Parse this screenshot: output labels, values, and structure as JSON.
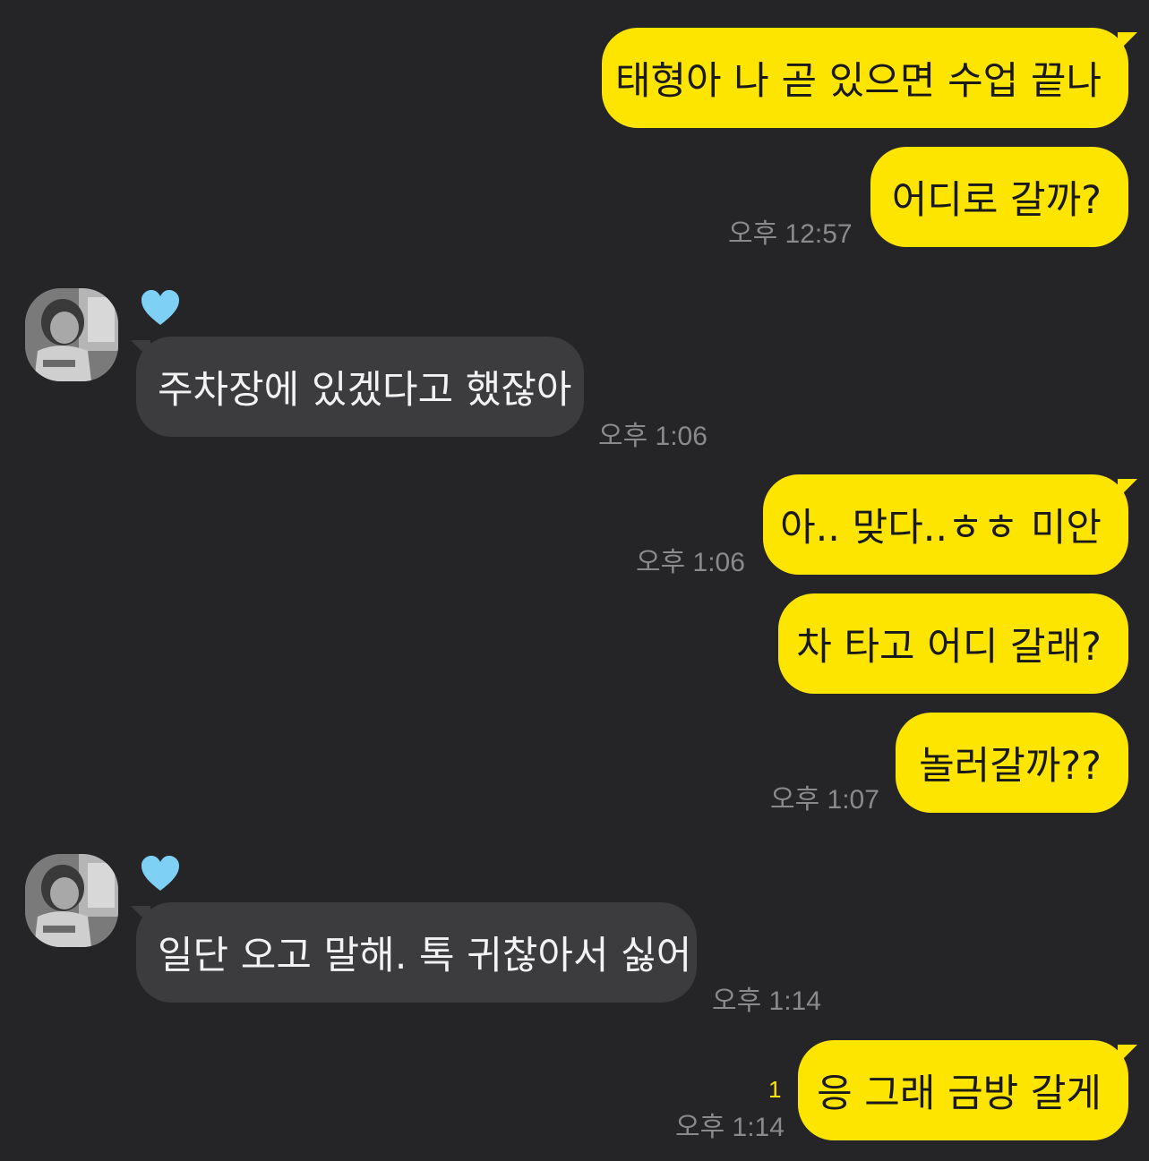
{
  "conversation": {
    "messages": [
      {
        "sender": "me",
        "text": "태형아 나 곧 있으면 수업 끝나"
      },
      {
        "sender": "me",
        "text": "어디로 갈까?",
        "time": "오후 12:57"
      },
      {
        "sender": "them",
        "text": "주차장에 있겠다고 했잖아",
        "time": "오후 1:06"
      },
      {
        "sender": "me",
        "text": "아.. 맞다..ㅎㅎ 미안",
        "time": "오후 1:06"
      },
      {
        "sender": "me",
        "text": "차 타고 어디 갈래?"
      },
      {
        "sender": "me",
        "text": "놀러갈까??",
        "time": "오후 1:07"
      },
      {
        "sender": "them",
        "text": "일단 오고 말해. 톡 귀찮아서 싫어",
        "time": "오후 1:14"
      },
      {
        "sender": "me",
        "text": "응 그래 금방 갈게",
        "time": "오후 1:14",
        "unread": "1"
      }
    ],
    "contact": {
      "name_icon": "light-blue-heart-icon",
      "avatar_icon": "profile-photo-icon"
    }
  },
  "colors": {
    "background": "#252527",
    "my_bubble": "#fee500",
    "their_bubble": "#3c3c3e",
    "timestamp": "#8a8a8c",
    "unread_count": "#fee500",
    "heart": "#7fd0f5"
  }
}
